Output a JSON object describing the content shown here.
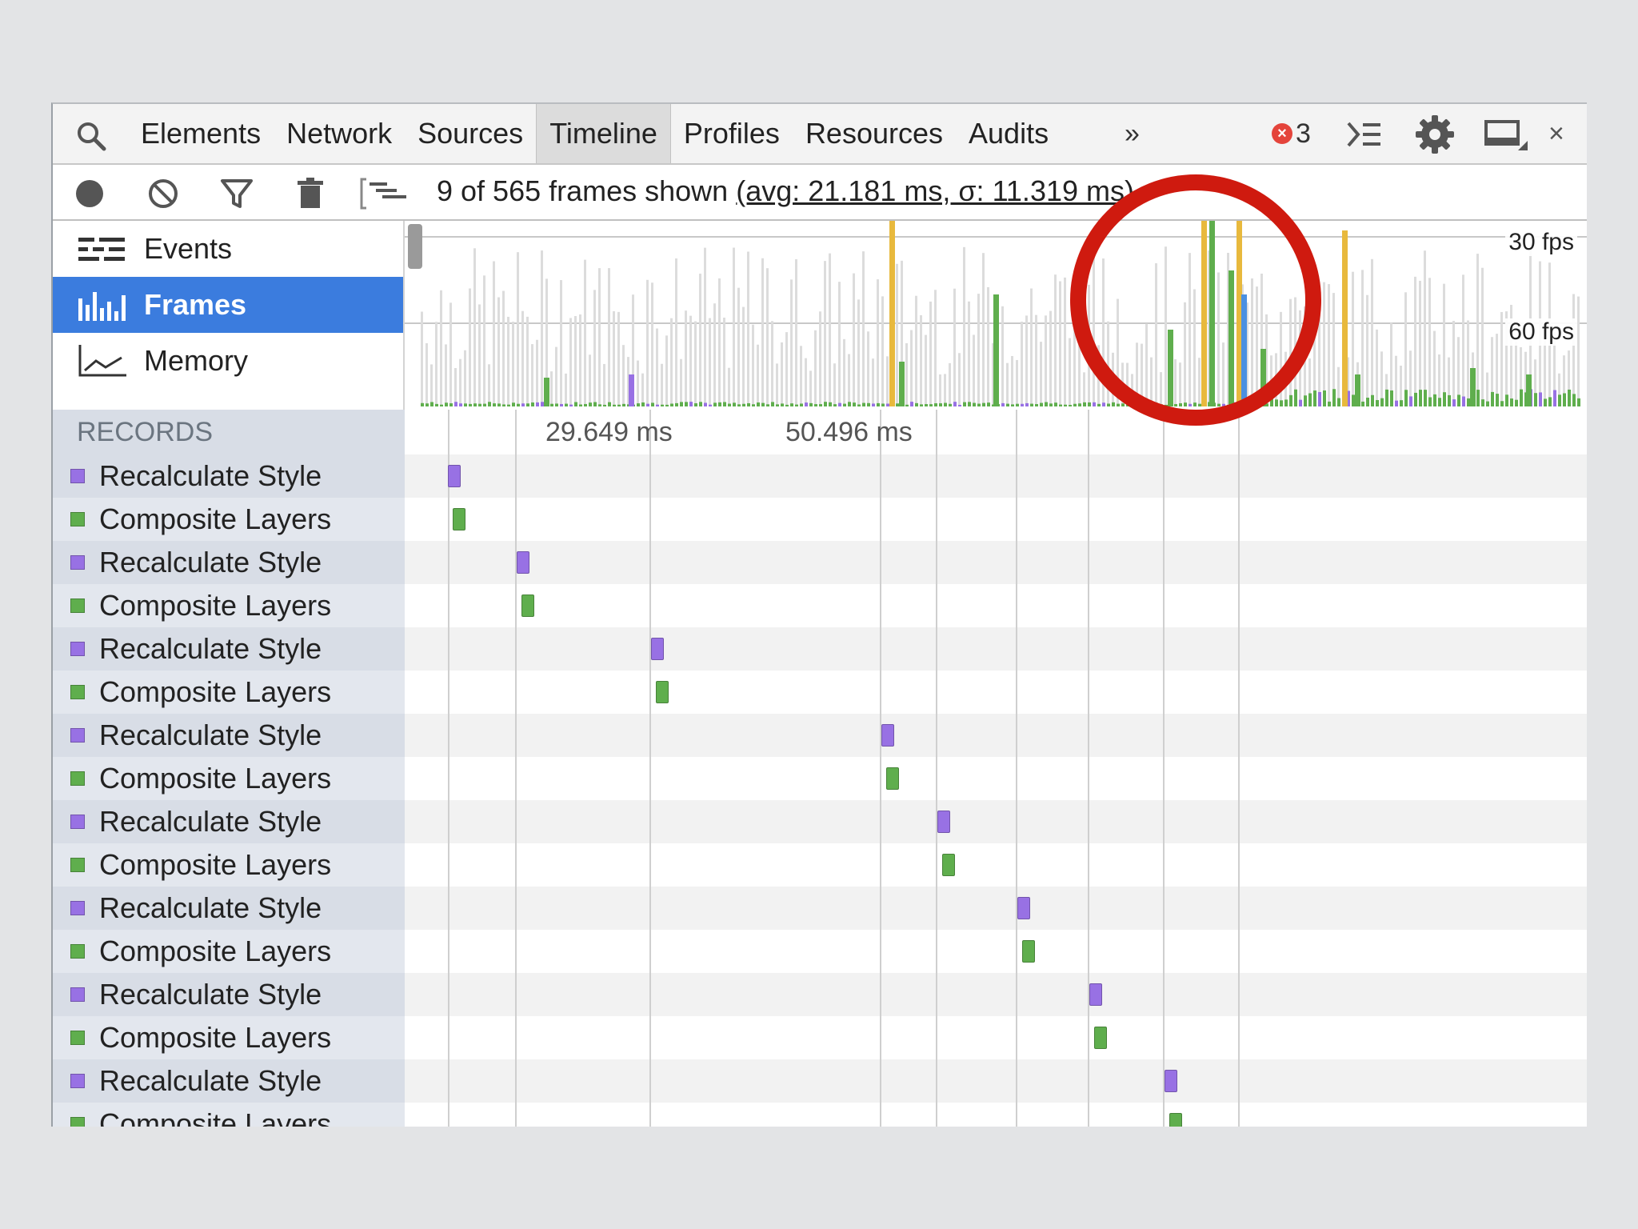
{
  "tabs": [
    {
      "label": "Elements",
      "active": false
    },
    {
      "label": "Network",
      "active": false
    },
    {
      "label": "Sources",
      "active": false
    },
    {
      "label": "Timeline",
      "active": true
    },
    {
      "label": "Profiles",
      "active": false
    },
    {
      "label": "Resources",
      "active": false
    },
    {
      "label": "Audits",
      "active": false
    }
  ],
  "overflow_label": "»",
  "error_count": "3",
  "close_label": "×",
  "toolbar": {
    "icons": [
      "record-icon",
      "clear-icon",
      "filter-icon",
      "garbage-collect-icon",
      "flame-chart-icon"
    ],
    "frames_prefix": "9 of 565 frames shown ",
    "frames_stats": "(avg: 21.181 ms, σ: 11.319 ms)"
  },
  "modes": [
    {
      "label": "Events",
      "icon": "events-icon",
      "selected": false
    },
    {
      "label": "Frames",
      "icon": "frames-icon",
      "selected": true
    },
    {
      "label": "Memory",
      "icon": "memory-icon",
      "selected": false
    }
  ],
  "fps_labels": {
    "fps30": "30 fps",
    "fps60": "60 fps"
  },
  "records_header": "RECORDS",
  "time_labels": [
    "29.649 ms",
    "50.496 ms"
  ],
  "colors": {
    "scripting": "#e8b93d",
    "rendering": "#9871e4",
    "painting": "#5fae4d",
    "loading": "#4a90e2",
    "selected": "#3b7cde",
    "annotation": "#cf1a0f"
  },
  "records": [
    {
      "label": "Recalculate Style",
      "category": "rendering",
      "frame": 0
    },
    {
      "label": "Composite Layers",
      "category": "painting",
      "frame": 0
    },
    {
      "label": "Recalculate Style",
      "category": "rendering",
      "frame": 1
    },
    {
      "label": "Composite Layers",
      "category": "painting",
      "frame": 1
    },
    {
      "label": "Recalculate Style",
      "category": "rendering",
      "frame": 2
    },
    {
      "label": "Composite Layers",
      "category": "painting",
      "frame": 2
    },
    {
      "label": "Recalculate Style",
      "category": "rendering",
      "frame": 3
    },
    {
      "label": "Composite Layers",
      "category": "painting",
      "frame": 3
    },
    {
      "label": "Recalculate Style",
      "category": "rendering",
      "frame": 4
    },
    {
      "label": "Composite Layers",
      "category": "painting",
      "frame": 4
    },
    {
      "label": "Recalculate Style",
      "category": "rendering",
      "frame": 5
    },
    {
      "label": "Composite Layers",
      "category": "painting",
      "frame": 5
    },
    {
      "label": "Recalculate Style",
      "category": "rendering",
      "frame": 6
    },
    {
      "label": "Composite Layers",
      "category": "painting",
      "frame": 6
    },
    {
      "label": "Recalculate Style",
      "category": "rendering",
      "frame": 7
    },
    {
      "label": "Composite Layers",
      "category": "painting",
      "frame": 7
    }
  ]
}
